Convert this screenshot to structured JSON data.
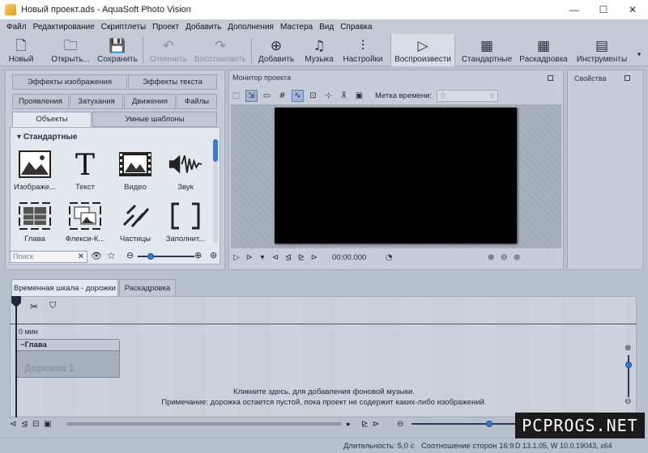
{
  "window": {
    "title": "Новый проект.ads - AquaSoft Photo Vision",
    "minimize": "—",
    "maximize": "☐",
    "close": "✕"
  },
  "menu": [
    "Файл",
    "Редактирование",
    "Скриптлеты",
    "Проект",
    "Добавить",
    "Дополнения",
    "Мастера",
    "Вид",
    "Справка"
  ],
  "toolbar": {
    "new": "Новый",
    "open": "Открыть...",
    "save": "Сохранить",
    "undo": "Отменить",
    "redo": "Восстановить",
    "add": "Добавить",
    "music": "Музыка",
    "settings": "Настройки",
    "play": "Воспроизвести",
    "standard": "Стандартные",
    "storyboard": "Раскадровка",
    "tools": "Инструменты"
  },
  "left_panel": {
    "tabs_row1": [
      "Эффекты изображения",
      "Эффекты текста"
    ],
    "tabs_row2": [
      "Проявления",
      "Затухания",
      "Движения",
      "Файлы"
    ],
    "tabs_row3": [
      "Объекты",
      "Умные шаблоны"
    ],
    "section_title": "Стандартные",
    "objects": [
      {
        "label": "Изображе...",
        "icon": "image-icon"
      },
      {
        "label": "Текст",
        "icon": "text-icon"
      },
      {
        "label": "Видео",
        "icon": "video-icon"
      },
      {
        "label": "Звук",
        "icon": "sound-icon"
      },
      {
        "label": "Глава",
        "icon": "chapter-icon"
      },
      {
        "label": "Флекси-К...",
        "icon": "flexi-collage-icon"
      },
      {
        "label": "Частицы",
        "icon": "particles-icon"
      },
      {
        "label": "Заполнит...",
        "icon": "placeholder-icon"
      }
    ],
    "search_placeholder": "Поиск"
  },
  "monitor": {
    "title": "Монитор проекта",
    "timestamp_label": "Метка времени:",
    "timestamp_value": "0",
    "timestamp_unit": "с",
    "time_display": "00:00.000"
  },
  "properties": {
    "title": "Свойства"
  },
  "timeline": {
    "tabs": [
      "Временная шкала - дорожки",
      "Раскадровка"
    ],
    "zero_label": "0 мин",
    "chapter_label": "Глава",
    "track_label": "Дорожка 1",
    "music_hint_1": "Кликните здесь, для добавления фоновой музыки.",
    "music_hint_2": "Примечание: дорожка остается пустой, пока проект не содержит каких-либо изображений."
  },
  "status": {
    "duration": "Длительность: 5,0 с",
    "aspect": "Соотношение сторон 16:9",
    "version": "D 13.1.05, W 10.0.19043, x64"
  },
  "watermark": "PCPROGS.NET",
  "colors": {
    "accent": "#2e7be0",
    "panel": "#c7cdd8",
    "background": "#b8bfcd"
  }
}
